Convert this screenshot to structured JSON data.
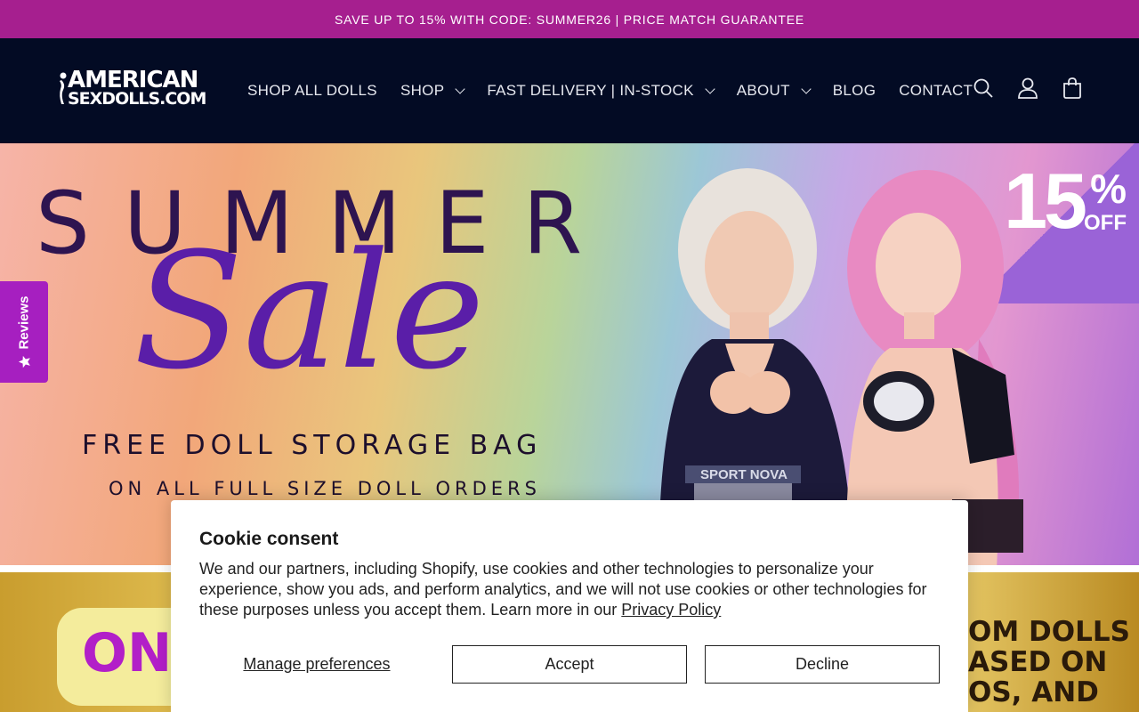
{
  "announcement": {
    "text": "SAVE UP TO 15% WITH CODE: SUMMER26 | PRICE MATCH GUARANTEE"
  },
  "header": {
    "logo": {
      "line1": "AMERICAN",
      "line2": "SEXDOLLS.COM"
    },
    "nav": [
      {
        "label": "SHOP ALL DOLLS",
        "has_dropdown": false
      },
      {
        "label": "SHOP",
        "has_dropdown": true
      },
      {
        "label": "FAST DELIVERY | IN-STOCK",
        "has_dropdown": true
      },
      {
        "label": "ABOUT",
        "has_dropdown": true
      },
      {
        "label": "BLOG",
        "has_dropdown": false
      },
      {
        "label": "CONTACT",
        "has_dropdown": false
      }
    ],
    "icons": [
      "search-icon",
      "account-icon",
      "cart-icon"
    ]
  },
  "hero": {
    "headline": "SUMMER",
    "script": "Sale",
    "line1": "FREE DOLL STORAGE BAG",
    "line2": "ON ALL FULL SIZE DOLL ORDERS",
    "badge_number": "15",
    "badge_percent": "%",
    "badge_off": "OFF",
    "shirt_text": "SPORT NOVA"
  },
  "reviews_tab": {
    "label": "Reviews",
    "icon": "star-icon"
  },
  "band": {
    "left_text": "ON",
    "right_text": "OM DOLLS\nASED ON\nOS, AND"
  },
  "cookie": {
    "title": "Cookie consent",
    "body": "We and our partners, including Shopify, use cookies and other technologies to personalize your experience, show you ads, and perform analytics, and we will not use cookies or other technologies for these purposes unless you accept them. Learn more in our ",
    "policy_link": "Privacy Policy",
    "manage_label": "Manage preferences",
    "accept_label": "Accept",
    "decline_label": "Decline"
  },
  "colors": {
    "announcement_bg": "#a61f8f",
    "header_bg": "#030b24",
    "reviews_bg": "#a61fc0"
  }
}
